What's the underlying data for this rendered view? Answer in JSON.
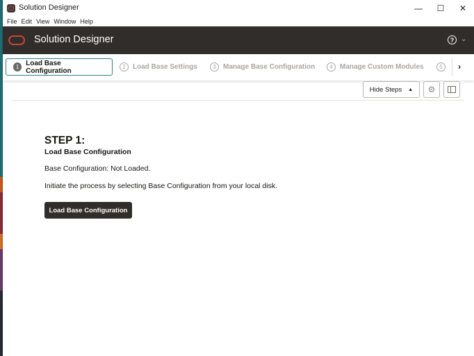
{
  "window": {
    "title": "Solution Designer",
    "controls": {
      "minimize": "—",
      "maximize": "☐",
      "close": "✕"
    }
  },
  "menu": [
    "File",
    "Edit",
    "View",
    "Window",
    "Help"
  ],
  "header": {
    "app_name": "Solution Designer",
    "help_symbol": "?",
    "chevron": "⌄"
  },
  "train": {
    "steps": [
      {
        "number": "1",
        "label": "Load Base Configuration",
        "active": true
      },
      {
        "number": "2",
        "label": "Load Base Settings",
        "active": false
      },
      {
        "number": "3",
        "label": "Manage Base Configuration",
        "active": false
      },
      {
        "number": "4",
        "label": "Manage Custom Modules",
        "active": false
      },
      {
        "number": "5",
        "label": "",
        "active": false
      }
    ],
    "next_symbol": "›"
  },
  "toolbar": {
    "hide_steps_label": "Hide Steps",
    "hide_steps_caret": "▲",
    "gear_symbol": "⚙"
  },
  "content": {
    "step_heading": "STEP 1:",
    "step_subtitle": "Load Base Configuration",
    "status": "Base Configuration: Not Loaded.",
    "instruction": "Initiate the process by selecting Base Configuration from your local disk.",
    "button_label": "Load Base Configuration"
  },
  "colors": {
    "header_bg": "#312d2a",
    "brand_red": "#c74634",
    "active_border": "#2a7f8a",
    "primary_button": "#312d2a"
  }
}
